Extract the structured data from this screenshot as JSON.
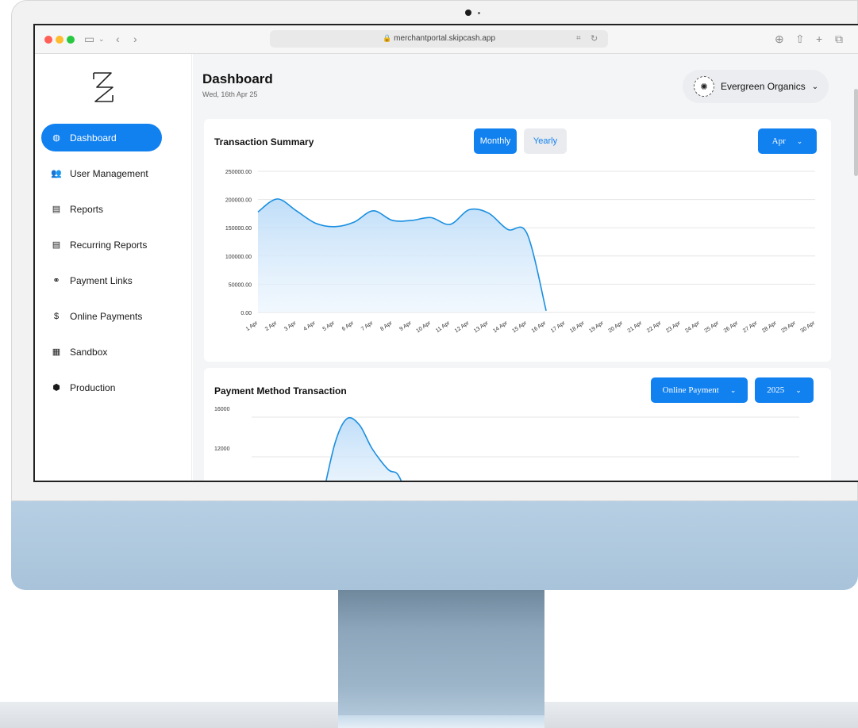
{
  "browser": {
    "url": "merchantportal.skipcash.app"
  },
  "sidebar": {
    "items": [
      {
        "label": "Dashboard",
        "icon": "dashboard-icon",
        "active": true
      },
      {
        "label": "User Management",
        "icon": "users-icon",
        "active": false
      },
      {
        "label": "Reports",
        "icon": "document-icon",
        "active": false
      },
      {
        "label": "Recurring Reports",
        "icon": "document-icon",
        "active": false
      },
      {
        "label": "Payment Links",
        "icon": "link-icon",
        "active": false
      },
      {
        "label": "Online Payments",
        "icon": "dollar-icon",
        "active": false
      },
      {
        "label": "Sandbox",
        "icon": "sandbox-icon",
        "active": false
      },
      {
        "label": "Production",
        "icon": "cube-icon",
        "active": false
      }
    ]
  },
  "header": {
    "title": "Dashboard",
    "date": "Wed, 16th Apr 25",
    "merchant_name": "Evergreen Organics"
  },
  "transaction_summary": {
    "title": "Transaction Summary",
    "monthly_label": "Monthly",
    "yearly_label": "Yearly",
    "month_select": "Apr"
  },
  "payment_method": {
    "title": "Payment Method Transaction",
    "method_select": "Online Payment",
    "year_select": "2025"
  },
  "colors": {
    "accent": "#1181f0",
    "line": "#1a8fe0",
    "fill": "#cfe6fb"
  },
  "chart_data": [
    {
      "type": "area",
      "title": "Transaction Summary",
      "x": [
        "1 Apr",
        "2 Apr",
        "3 Apr",
        "4 Apr",
        "5 Apr",
        "6 Apr",
        "7 Apr",
        "8 Apr",
        "9 Apr",
        "10 Apr",
        "11 Apr",
        "12 Apr",
        "13 Apr",
        "14 Apr",
        "15 Apr",
        "16 Apr",
        "17 Apr",
        "18 Apr",
        "19 Apr",
        "20 Apr",
        "21 Apr",
        "22 Apr",
        "23 Apr",
        "24 Apr",
        "25 Apr",
        "26 Apr",
        "27 Apr",
        "28 Apr",
        "29 Apr",
        "30 Apr"
      ],
      "series": [
        {
          "values": [
            178000,
            201000,
            180000,
            158000,
            152000,
            160000,
            180000,
            163000,
            163000,
            168000,
            156000,
            182000,
            176000,
            147000,
            140000,
            3000
          ]
        }
      ],
      "yticks": [
        "0.00",
        "50000.00",
        "100000.00",
        "150000.00",
        "200000.00",
        "250000.00"
      ],
      "ylim": [
        0,
        250000
      ],
      "grid": true
    },
    {
      "type": "area",
      "title": "Payment Method Transaction",
      "yticks": [
        "12000",
        "16000"
      ],
      "ylim": [
        0,
        18000
      ],
      "grid": true
    }
  ]
}
